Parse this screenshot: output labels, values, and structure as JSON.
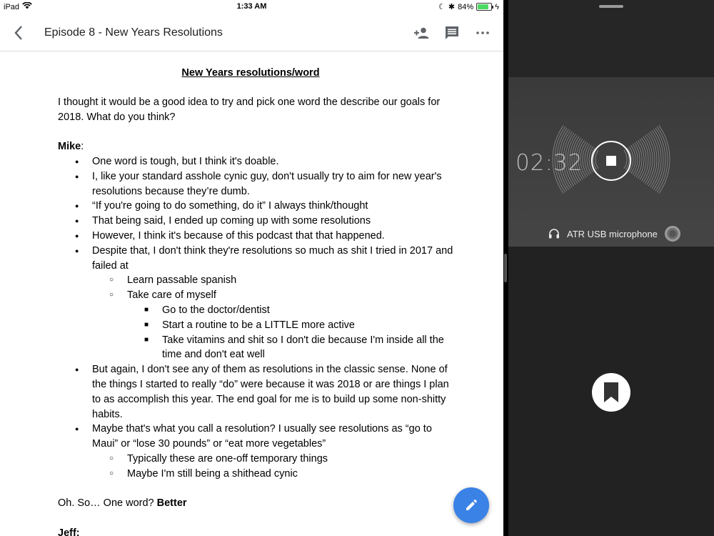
{
  "status": {
    "device": "iPad",
    "time": "1:33 AM",
    "battery": "84%",
    "battery_level": 0.84
  },
  "toolbar": {
    "title": "Episode 8 - New Years Resolutions"
  },
  "document": {
    "title": "New Years resolutions/word",
    "intro": "I thought it would be a good idea to try and pick one word the describe our goals for 2018. What do you think?",
    "mike_label": "Mike",
    "mike_colon": ":",
    "mike_items": [
      "One word is tough, but I think it's doable.",
      "I, like your standard asshole cynic guy, don't usually try to aim for new year's resolutions because they’re dumb.",
      "“If you're going to do something, do it” I always think/thought",
      "That being said, I ended up coming up with some resolutions",
      "However, I think it's because of this podcast that that happened.",
      "Despite that, I don't think they're resolutions so much as shit I tried in 2017 and failed at"
    ],
    "sub_items": [
      "Learn passable spanish",
      "Take care of myself"
    ],
    "subsub_items": [
      "Go to the doctor/dentist",
      "Start a routine to be a LITTLE more active",
      "Take vitamins and shit so I don't die because I'm inside all the time and don't eat well"
    ],
    "mike_items2": [
      "But again, I don't see any of them as resolutions in the classic sense. None of the things I started to really “do” were because it was 2018 or are things I plan to as accomplish this year. The end goal for me is to build up some non-shitty habits.",
      "Maybe that's what you call a resolution? I usually see resolutions as “go to Maui” or “lose 30 pounds” or “eat more vegetables”"
    ],
    "sub_items2": [
      "Typically these are one-off temporary things",
      "Maybe I'm still being a shithead cynic"
    ],
    "closing_plain": "Oh. So… One word? ",
    "closing_bold": "Better",
    "jeff_label": "Jeff:"
  },
  "recorder": {
    "timer": "02:32",
    "mic_name": "ATR USB microphone"
  },
  "colors": {
    "fab": "#3b82e6",
    "battery": "#4cd964",
    "recorder_bg": "#1b1b1b"
  }
}
